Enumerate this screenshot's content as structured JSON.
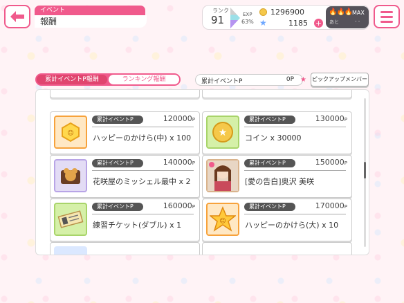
{
  "header": {
    "category": "イベント",
    "title": "報酬"
  },
  "status": {
    "rank_label": "ランク",
    "rank": "91",
    "exp_label": "EXP",
    "exp_percent": "63%",
    "coins": "1296900",
    "stars": "1185",
    "live_label": "MAX",
    "live_ato": "あと",
    "live_time": "- -"
  },
  "tabs": {
    "active": "累計イベントP報酬",
    "inactive": "ランキング報酬"
  },
  "points": {
    "label": "累計イベントP",
    "value": "0",
    "unit": "P"
  },
  "pickup_button": "ピックアップメンバー",
  "rewards": [
    {
      "badge": "累計イベントP",
      "points": "120000",
      "unit": "P",
      "name": "ハッピーのかけら(中) x 100",
      "icon": "happy-fragment-medium-icon"
    },
    {
      "badge": "累計イベントP",
      "points": "130000",
      "unit": "P",
      "name": "コイン x 30000",
      "icon": "coin-icon"
    },
    {
      "badge": "累計イベントP",
      "points": "140000",
      "unit": "P",
      "name": "花咲屋のミッシェル最中 x 2",
      "icon": "michelle-monaka-icon"
    },
    {
      "badge": "累計イベントP",
      "points": "150000",
      "unit": "P",
      "name": "[愛の告白]奥沢 美咲",
      "icon": "member-card-icon"
    },
    {
      "badge": "累計イベントP",
      "points": "160000",
      "unit": "P",
      "name": "練習チケット(ダブル) x 1",
      "icon": "practice-ticket-icon"
    },
    {
      "badge": "累計イベントP",
      "points": "170000",
      "unit": "P",
      "name": "ハッピーのかけら(大) x 10",
      "icon": "happy-fragment-large-icon"
    }
  ],
  "colors": {
    "accent": "#f05a8c",
    "badge": "#555555"
  }
}
